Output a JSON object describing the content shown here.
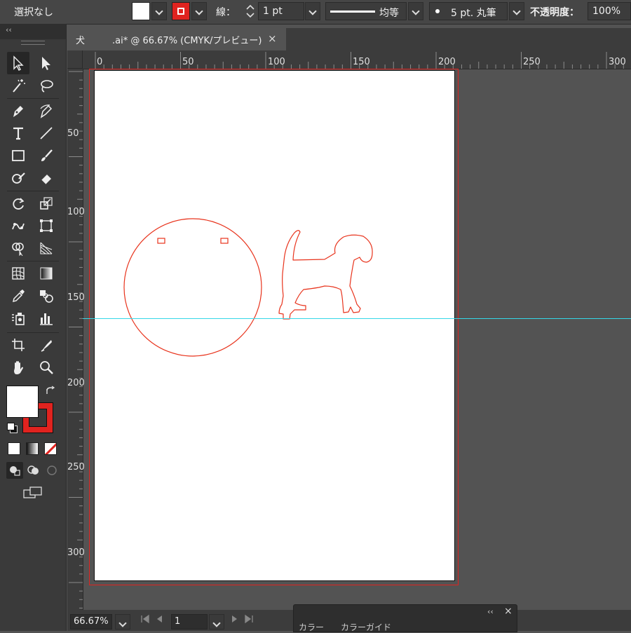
{
  "control_bar": {
    "selection_status": "選択なし",
    "stroke_label": "線：",
    "stroke_weight": "1 pt",
    "stroke_profile": "均等",
    "brush": "5 pt. 丸筆",
    "opacity_label": "不透明度：",
    "opacity_value": "100%"
  },
  "document_tab": {
    "title": "犬　　　.ai* @ 66.67% (CMYK/プレビュー)",
    "close": "×"
  },
  "tools_panel": {
    "collapse": "‹‹"
  },
  "ruler": {
    "top_ticks": [
      "0",
      "50",
      "100",
      "150",
      "200",
      "250",
      "300"
    ],
    "left_ticks": [
      "50",
      "100",
      "150",
      "200",
      "250",
      "300"
    ]
  },
  "status_bar": {
    "zoom": "66.67%",
    "page": "1"
  },
  "floating_panel": {
    "tabs": "カラー　　カラーガイド",
    "collapse": "‹‹",
    "close": "×"
  },
  "colors": {
    "stroke": "#e0231f",
    "fill": "#ffffff",
    "guide": "#34d8e8",
    "artwork": "#e8331c"
  }
}
